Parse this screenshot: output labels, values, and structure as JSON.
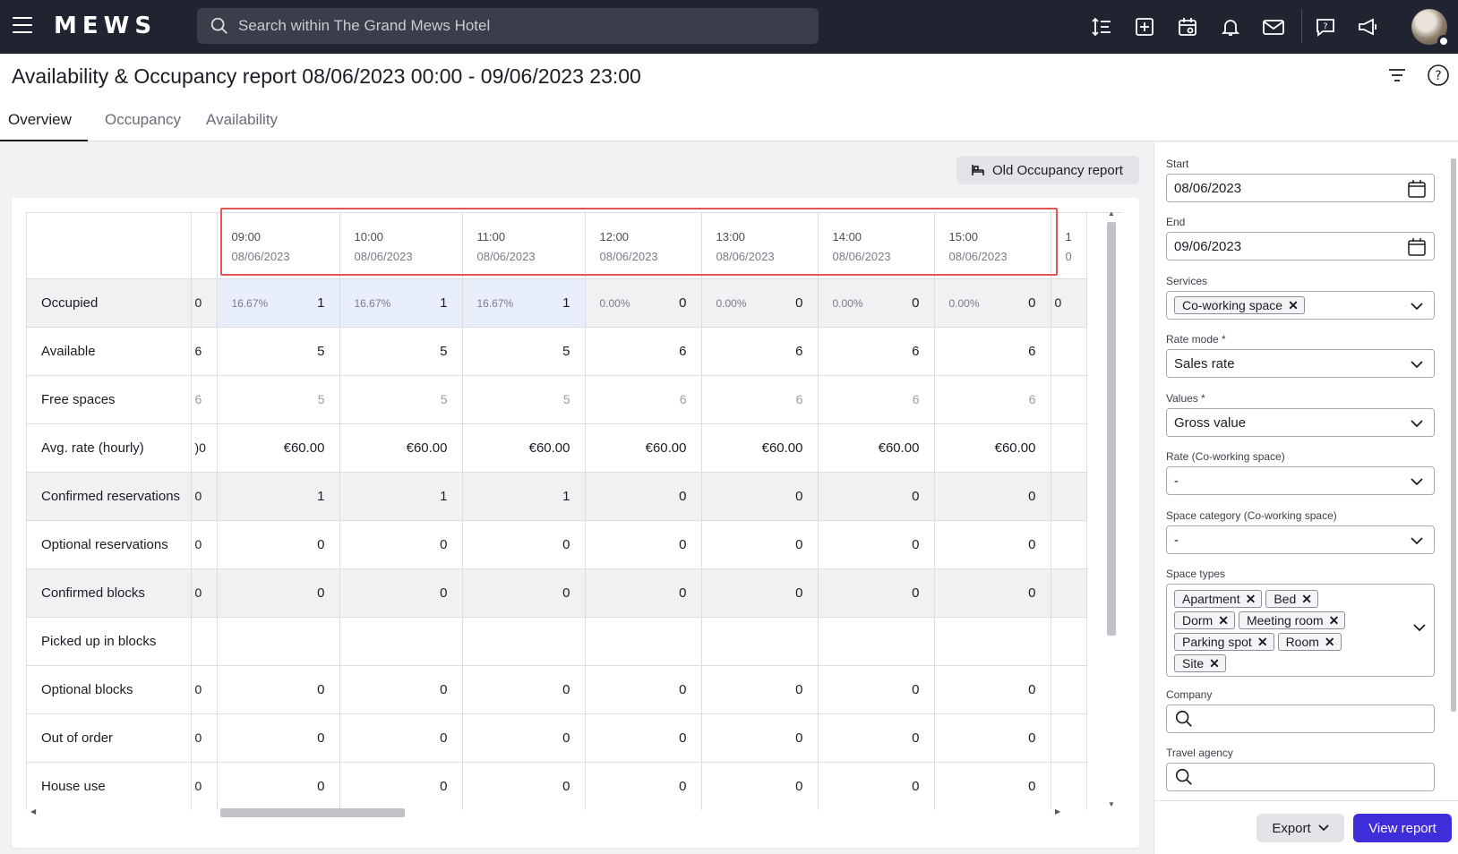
{
  "topbar": {
    "logo": "MEWS",
    "search_placeholder": "Search within The Grand Mews Hotel",
    "icons": [
      "sort-icon",
      "add-icon",
      "calendar-icon",
      "bell-icon",
      "mail-icon",
      "help-chat-icon",
      "megaphone-icon"
    ]
  },
  "header": {
    "title": "Availability & Occupancy report 08/06/2023 00:00 - 09/06/2023 23:00",
    "tabs": [
      {
        "label": "Overview",
        "active": true
      },
      {
        "label": "Occupancy",
        "active": false
      },
      {
        "label": "Availability",
        "active": false
      }
    ]
  },
  "main": {
    "old_report_label": "Old Occupancy report",
    "columns": [
      {
        "time": "09:00",
        "date": "08/06/2023"
      },
      {
        "time": "10:00",
        "date": "08/06/2023"
      },
      {
        "time": "11:00",
        "date": "08/06/2023"
      },
      {
        "time": "12:00",
        "date": "08/06/2023"
      },
      {
        "time": "13:00",
        "date": "08/06/2023"
      },
      {
        "time": "14:00",
        "date": "08/06/2023"
      },
      {
        "time": "15:00",
        "date": "08/06/2023"
      },
      {
        "time": "1",
        "date": "0"
      }
    ],
    "rows": [
      {
        "label": "Occupied",
        "partial": "0",
        "values": [
          "1",
          "1",
          "1",
          "0",
          "0",
          "0",
          "0"
        ],
        "pcts": [
          "16.67%",
          "16.67%",
          "16.67%",
          "0.00%",
          "0.00%",
          "0.00%",
          "0.00%"
        ],
        "edge": "0"
      },
      {
        "label": "Available",
        "partial": "6",
        "values": [
          "5",
          "5",
          "5",
          "6",
          "6",
          "6",
          "6"
        ],
        "edge": ""
      },
      {
        "label": "Free spaces",
        "partial": "6",
        "values": [
          "5",
          "5",
          "5",
          "6",
          "6",
          "6",
          "6"
        ],
        "edge": ""
      },
      {
        "label": "Avg. rate (hourly)",
        "partial": ")0",
        "values": [
          "€60.00",
          "€60.00",
          "€60.00",
          "€60.00",
          "€60.00",
          "€60.00",
          "€60.00"
        ],
        "edge": ""
      },
      {
        "label": "Confirmed reservations",
        "partial": "0",
        "values": [
          "1",
          "1",
          "1",
          "0",
          "0",
          "0",
          "0"
        ],
        "edge": ""
      },
      {
        "label": "Optional reservations",
        "partial": "0",
        "values": [
          "0",
          "0",
          "0",
          "0",
          "0",
          "0",
          "0"
        ],
        "edge": ""
      },
      {
        "label": "Confirmed blocks",
        "partial": "0",
        "values": [
          "0",
          "0",
          "0",
          "0",
          "0",
          "0",
          "0"
        ],
        "edge": ""
      },
      {
        "label": "Picked up in blocks",
        "partial": "",
        "values": [
          "",
          "",
          "",
          "",
          "",
          "",
          ""
        ],
        "edge": ""
      },
      {
        "label": "Optional blocks",
        "partial": "0",
        "values": [
          "0",
          "0",
          "0",
          "0",
          "0",
          "0",
          "0"
        ],
        "edge": ""
      },
      {
        "label": "Out of order",
        "partial": "0",
        "values": [
          "0",
          "0",
          "0",
          "0",
          "0",
          "0",
          "0"
        ],
        "edge": ""
      },
      {
        "label": "House use",
        "partial": "0",
        "values": [
          "0",
          "0",
          "0",
          "0",
          "0",
          "0",
          "0"
        ],
        "edge": ""
      }
    ]
  },
  "panel": {
    "start_label": "Start",
    "start_value": "08/06/2023",
    "end_label": "End",
    "end_value": "09/06/2023",
    "services_label": "Services",
    "services_chips": [
      "Co-working space"
    ],
    "rate_mode_label": "Rate mode *",
    "rate_mode_value": "Sales rate",
    "values_label": "Values *",
    "values_value": "Gross value",
    "rate_label": "Rate (Co-working space)",
    "rate_value": "-",
    "space_category_label": "Space category (Co-working space)",
    "space_category_value": "-",
    "space_types_label": "Space types",
    "space_types_chips": [
      "Apartment",
      "Bed",
      "Dorm",
      "Meeting room",
      "Parking spot",
      "Room",
      "Site"
    ],
    "company_label": "Company",
    "travel_agency_label": "Travel agency",
    "export_label": "Export",
    "view_label": "View report"
  }
}
